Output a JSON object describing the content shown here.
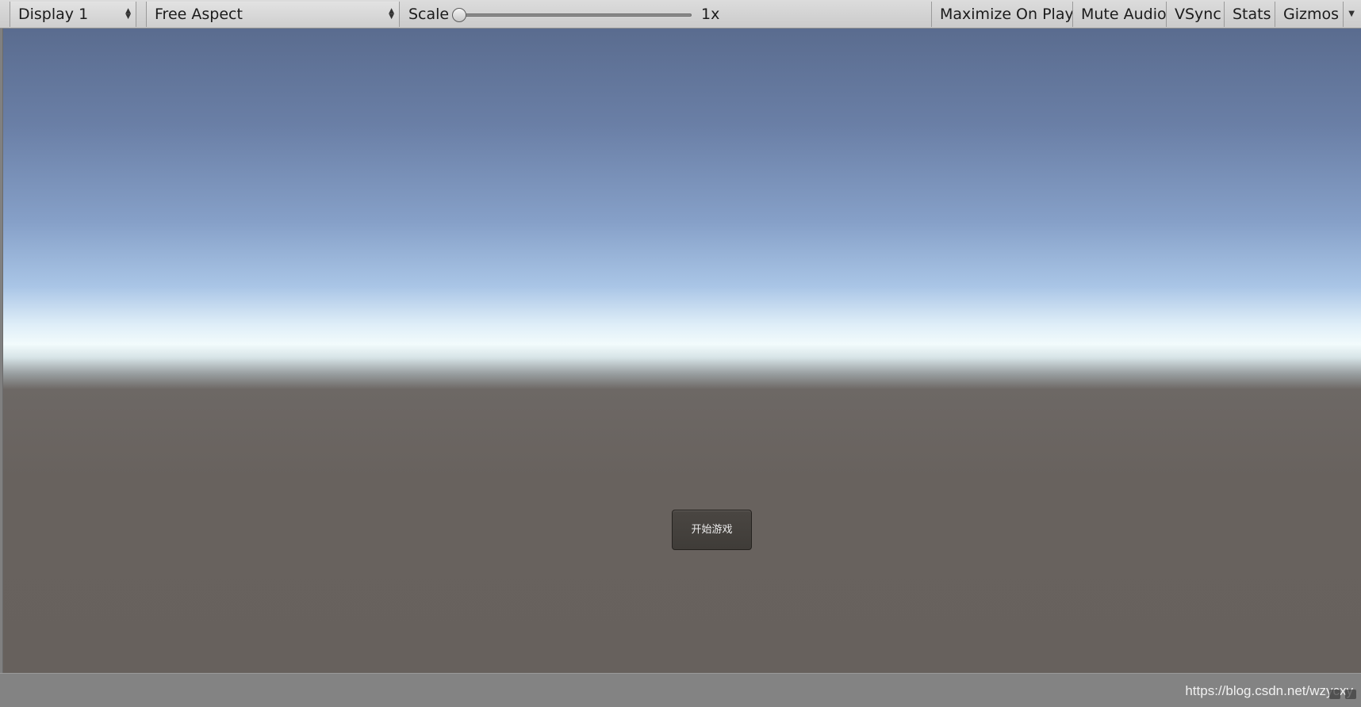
{
  "toolbar": {
    "display_dropdown": {
      "label": "Display 1"
    },
    "aspect_dropdown": {
      "label": "Free Aspect"
    },
    "scale": {
      "label": "Scale",
      "value_label": "1x",
      "level": 0
    },
    "buttons": {
      "maximize_on_play": "Maximize On Play",
      "mute_audio": "Mute Audio",
      "vsync": "VSync",
      "stats": "Stats",
      "gizmos": "Gizmos"
    },
    "icons": {
      "dropdown_arrows": "up-down-arrows-icon",
      "gizmos_menu": "chevron-down-icon"
    }
  },
  "game_view": {
    "start_button_label": "开始游戏"
  },
  "status": {
    "watermark": "https://blog.csdn.net/wzycxy"
  }
}
